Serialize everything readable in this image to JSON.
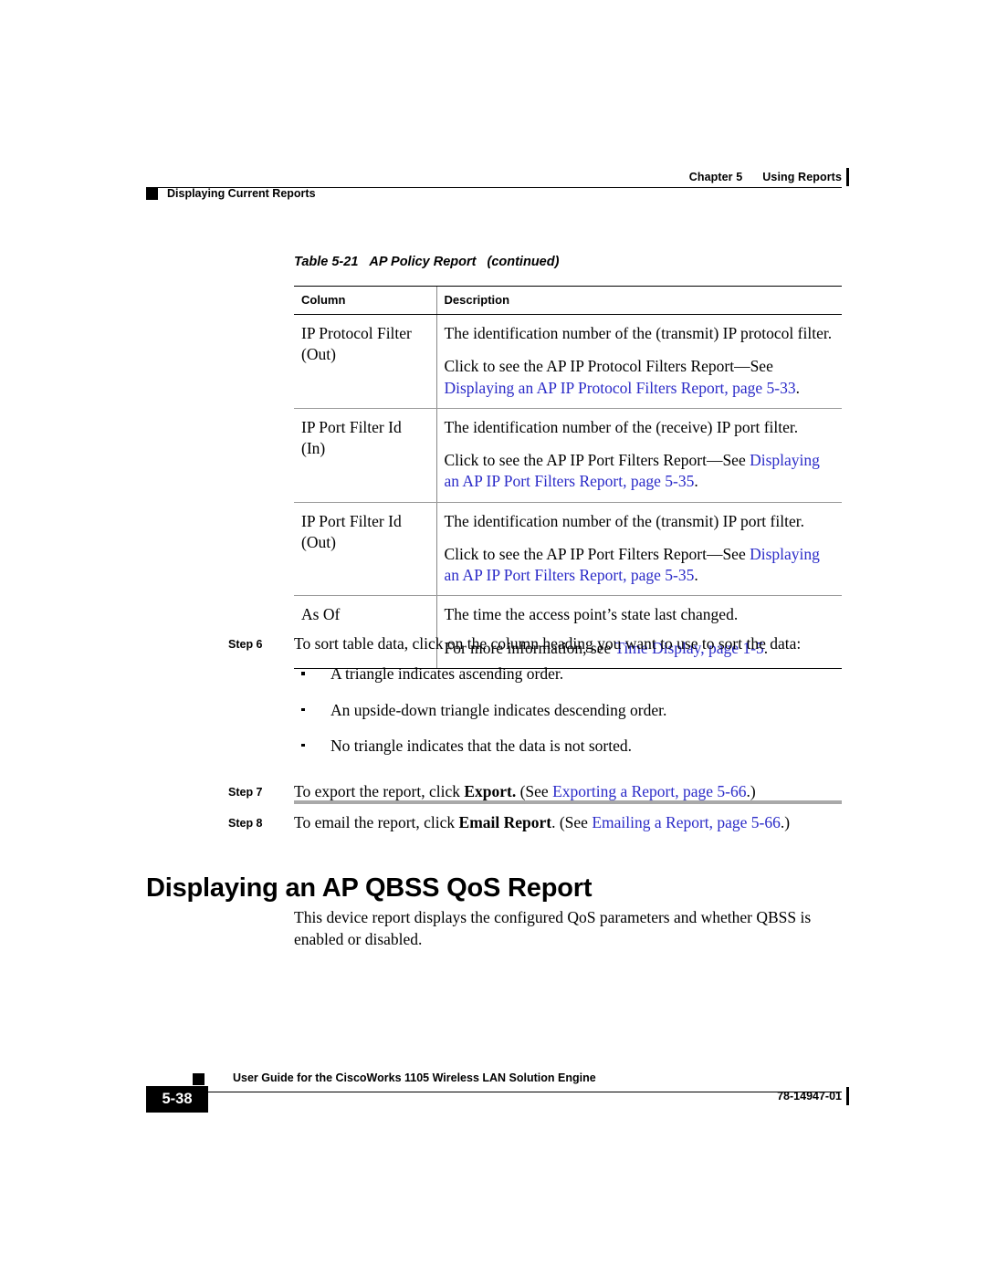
{
  "header": {
    "chapter": "Chapter 5",
    "chapter_title": "Using Reports",
    "section": "Displaying Current Reports"
  },
  "table": {
    "caption_number": "Table 5-21",
    "caption_title": "AP Policy Report",
    "caption_continued": "(continued)",
    "columns": [
      "Column",
      "Description"
    ],
    "rows": [
      {
        "column": "IP Protocol Filter (Out)",
        "paragraphs": [
          {
            "plain": "The identification number of the (transmit) IP protocol filter."
          },
          {
            "lead": "Click to see the AP IP Protocol Filters Report—See ",
            "link": "Displaying an AP IP Protocol Filters Report, page 5-33",
            "tail": "."
          }
        ]
      },
      {
        "column": "IP Port Filter Id (In)",
        "paragraphs": [
          {
            "plain": "The identification number of the (receive) IP port filter."
          },
          {
            "lead": "Click to see the AP IP Port Filters Report—See ",
            "link": "Displaying an AP IP Port Filters Report, page 5-35",
            "tail": "."
          }
        ]
      },
      {
        "column": "IP Port Filter Id (Out)",
        "paragraphs": [
          {
            "plain": "The identification number of the (transmit) IP port filter."
          },
          {
            "lead": "Click to see the AP IP Port Filters Report—See ",
            "link": "Displaying an AP IP Port Filters Report, page 5-35",
            "tail": "."
          }
        ]
      },
      {
        "column": "As Of",
        "paragraphs": [
          {
            "plain": "The time the access point’s state last changed."
          },
          {
            "lead": "For more information, see ",
            "link": "Time Display, page 1-5",
            "tail": "."
          }
        ]
      }
    ]
  },
  "steps": {
    "step6": {
      "label": "Step 6",
      "text": "To sort table data, click on the column heading you want to use to sort the data:",
      "bullets": [
        "A triangle indicates ascending order.",
        "An upside-down triangle indicates descending order.",
        "No triangle indicates that the data is not sorted."
      ]
    },
    "step7": {
      "label": "Step 7",
      "lead": "To export the report, click ",
      "bold": "Export.",
      "mid": " (See ",
      "link": "Exporting a Report, page 5-66",
      "tail": ".)"
    },
    "step8": {
      "label": "Step 8",
      "lead": "To email the report, click ",
      "bold": "Email Report",
      "mid": ". (See ",
      "link": "Emailing a Report, page 5-66",
      "tail": ".)"
    }
  },
  "section": {
    "heading": "Displaying an AP QBSS QoS Report",
    "paragraph": "This device report displays the configured QoS parameters and whether QBSS is enabled or disabled."
  },
  "footer": {
    "guide_title": "User Guide for the CiscoWorks 1105 Wireless LAN Solution Engine",
    "page_number": "5-38",
    "doc_number": "78-14947-01"
  },
  "colors": {
    "link": "#2b2bc8",
    "rule": "#000000",
    "row_divider": "#9a9a9a",
    "separator": "#a9a9a9"
  }
}
